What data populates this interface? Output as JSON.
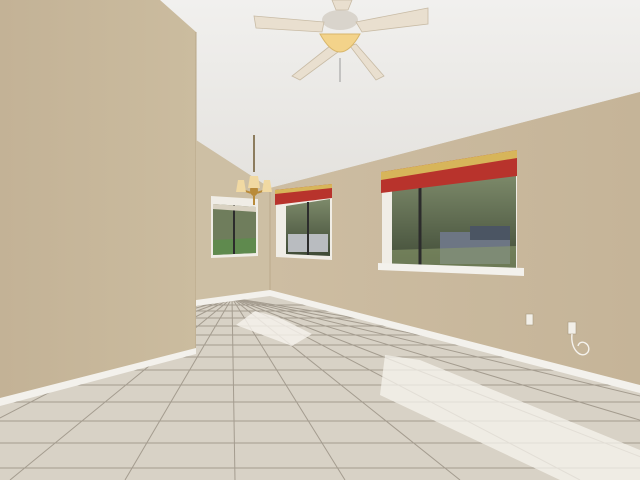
{
  "scene": {
    "description_free": true,
    "colors": {
      "ceiling": "#ecebe8",
      "wall_left": "#c8b89c",
      "wall_back_left": "#cdbfa4",
      "wall_right": "#cbbb9f",
      "floor_tile": "#d8d2c6",
      "grout": "#a49c8f",
      "baseboard": "#f3f1ec",
      "window_frame": "#f0ede6",
      "valance_red": "#b8332c",
      "valance_gold": "#d7b55a",
      "sun_patch": "#f7f4ee",
      "fan_blade": "#e9dfcf",
      "fan_light": "#f3d38a",
      "chandelier": "#b98b3a"
    },
    "icons": [
      "ceiling-fan-icon",
      "chandelier-icon",
      "outlet-icon"
    ]
  }
}
